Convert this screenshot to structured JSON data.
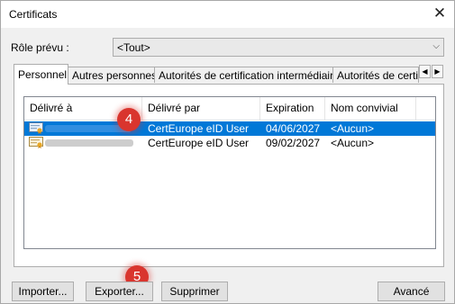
{
  "window": {
    "title": "Certificats",
    "close_glyph": "✕"
  },
  "role": {
    "label": "Rôle prévu :",
    "value": "<Tout>"
  },
  "tabs": [
    {
      "label": "Personnel"
    },
    {
      "label": "Autres personnes"
    },
    {
      "label": "Autorités de certification intermédiaires"
    },
    {
      "label": "Autorités de certi"
    }
  ],
  "columns": [
    "Délivré à",
    "Délivré par",
    "Expiration",
    "Nom convivial"
  ],
  "rows": [
    {
      "issued_by": "CertEurope eID User",
      "expiration": "04/06/2027",
      "friendly_name": "<Aucun>",
      "selected": true
    },
    {
      "issued_by": "CertEurope eID User",
      "expiration": "09/02/2027",
      "friendly_name": "<Aucun>",
      "selected": false
    }
  ],
  "badges": [
    "4",
    "5"
  ],
  "buttons": {
    "import": "Importer...",
    "export": "Exporter...",
    "delete": "Supprimer",
    "advanced": "Avancé"
  },
  "colors": {
    "selection": "#0078d7",
    "badge": "#d9352e"
  }
}
